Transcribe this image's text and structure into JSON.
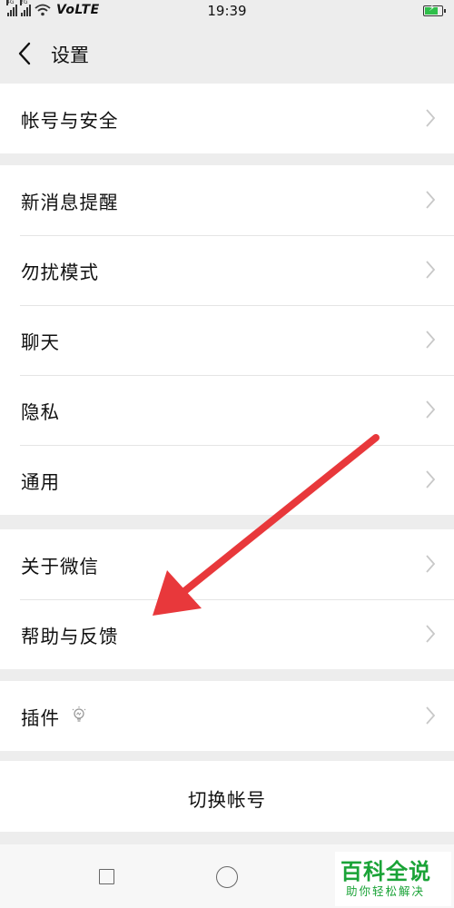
{
  "status_bar": {
    "network_1": "4G",
    "network_2": "2G",
    "volte": "VoLTE",
    "time": "19:39",
    "battery_level": 0.85
  },
  "header": {
    "back_icon": "chevron-left-icon",
    "title": "设置"
  },
  "groups": [
    {
      "items": [
        {
          "label": "帐号与安全"
        }
      ]
    },
    {
      "items": [
        {
          "label": "新消息提醒"
        },
        {
          "label": "勿扰模式"
        },
        {
          "label": "聊天"
        },
        {
          "label": "隐私"
        },
        {
          "label": "通用"
        }
      ]
    },
    {
      "items": [
        {
          "label": "关于微信"
        },
        {
          "label": "帮助与反馈"
        }
      ]
    },
    {
      "items": [
        {
          "label": "插件",
          "badge_icon": "lightbulb-icon"
        }
      ]
    }
  ],
  "switch_account": {
    "label": "切换帐号"
  },
  "annotation": {
    "color": "#e8383b"
  },
  "watermark": {
    "title": "百科全说",
    "subtitle": "助你轻松解决",
    "color": "#1aa337"
  },
  "softkeys": {
    "recents_icon": "square-icon",
    "home_icon": "circle-icon"
  }
}
